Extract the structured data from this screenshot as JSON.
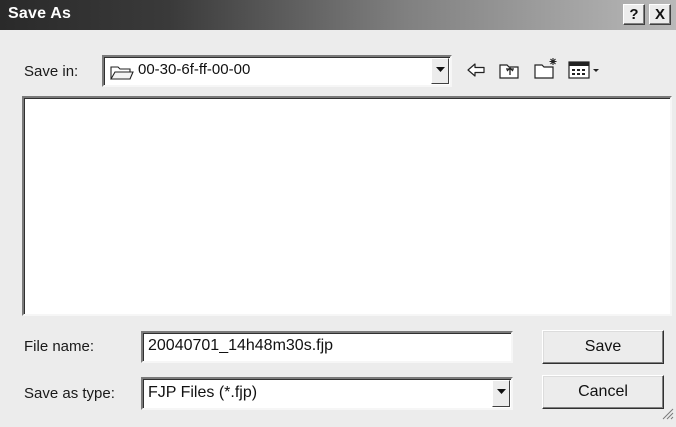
{
  "window": {
    "title": "Save As",
    "help_label": "?",
    "close_label": "X"
  },
  "save_in": {
    "label": "Save in:",
    "value": "00-30-6f-ff-00-00",
    "folder_icon": "folder-icon"
  },
  "toolbar": {
    "icons": [
      "back-arrow-icon",
      "up-one-level-icon",
      "create-new-folder-icon",
      "view-menu-icon"
    ]
  },
  "file_list": {
    "items": []
  },
  "file_name": {
    "label": "File name:",
    "value": "20040701_14h48m30s.fjp"
  },
  "save_as_type": {
    "label": "Save as type:",
    "value": "FJP Files (*.fjp)"
  },
  "buttons": {
    "save": "Save",
    "cancel": "Cancel"
  }
}
